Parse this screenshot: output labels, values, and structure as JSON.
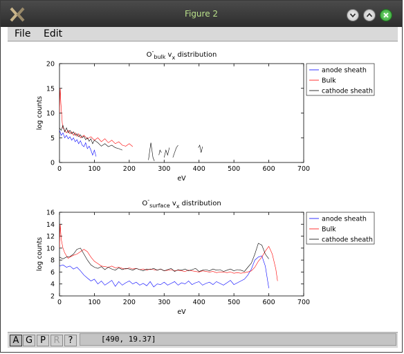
{
  "window": {
    "title": "Figure 2"
  },
  "menu": {
    "file": "File",
    "edit": "Edit"
  },
  "toolbar": {
    "a": "A",
    "g": "G",
    "p": "P",
    "r": "R",
    "help": "?"
  },
  "status": {
    "coords": "[490, 19.37]"
  },
  "chart_data": [
    {
      "type": "line",
      "title": {
        "base": "O",
        "sup": "-",
        "sub": "bulk",
        "mid": " v",
        "sub2": "x",
        "tail": " distribution"
      },
      "xlabel": "eV",
      "ylabel": "log counts",
      "xlim": [
        0,
        700
      ],
      "ylim": [
        0,
        20
      ],
      "xticks": [
        "0",
        "100",
        "200",
        "300",
        "400",
        "500",
        "600",
        "700"
      ],
      "yticks": [
        "0",
        "5",
        "10",
        "15",
        "20"
      ],
      "legend_position": "outside-right-top",
      "series": [
        {
          "name": "anode sheath",
          "color": "#0000ff",
          "x": [
            0,
            5,
            10,
            15,
            20,
            25,
            30,
            35,
            40,
            45,
            50,
            55,
            60,
            65,
            70,
            75,
            80,
            85,
            90,
            95,
            100,
            105
          ],
          "y": [
            6.5,
            5.5,
            6,
            5,
            5.5,
            4.8,
            5.2,
            4.5,
            5,
            4.2,
            4.6,
            3.8,
            4.4,
            3.5,
            3.2,
            4,
            2.8,
            3.3,
            2.5,
            1.5,
            2.5,
            1.2
          ]
        },
        {
          "name": "Bulk",
          "color": "#ff0000",
          "x": [
            0,
            2,
            4,
            6,
            8,
            10,
            15,
            20,
            25,
            30,
            35,
            40,
            45,
            50,
            55,
            60,
            70,
            80,
            90,
            100,
            110,
            120,
            130,
            140,
            150,
            160,
            170,
            180,
            190,
            200,
            210
          ],
          "y": [
            10,
            15,
            12,
            10,
            8,
            7,
            6.5,
            6,
            6.5,
            5.8,
            6.2,
            5.5,
            6,
            5.3,
            5.8,
            5,
            5.5,
            4.8,
            5.2,
            4.5,
            5,
            4.2,
            4.8,
            4,
            4.5,
            3.8,
            4.2,
            3.5,
            3.3,
            3.8,
            3.2
          ]
        },
        {
          "name": "cathode sheath",
          "color": "#000000",
          "x": [
            0,
            5,
            10,
            15,
            20,
            25,
            30,
            35,
            40,
            45,
            50,
            55,
            60,
            65,
            70,
            75,
            80,
            85,
            90,
            95,
            100,
            110,
            120,
            130,
            140,
            150,
            160,
            170,
            180
          ],
          "y": [
            7,
            6.5,
            7.5,
            6.2,
            7,
            6,
            6.5,
            5.8,
            6.2,
            5.5,
            5.8,
            5.2,
            5.6,
            5,
            5.3,
            4.6,
            5,
            4.3,
            4.8,
            3.8,
            4.5,
            4,
            3.3,
            3.8,
            3.2,
            3.5,
            3,
            2.8,
            2.5
          ],
          "segments": [
            {
              "x": [
                255,
                258,
                262,
                265,
                268,
                272
              ],
              "y": [
                0.5,
                2,
                4,
                2.5,
                1,
                0.3
              ]
            },
            {
              "x": [
                285,
                288,
                292
              ],
              "y": [
                1.5,
                2.5,
                2
              ]
            },
            {
              "x": [
                300,
                305,
                310,
                315
              ],
              "y": [
                1,
                2.5,
                1.5,
                3
              ]
            },
            {
              "x": [
                325,
                330,
                335,
                340
              ],
              "y": [
                1,
                2,
                3,
                3.5
              ]
            },
            {
              "x": [
                398,
                402,
                406,
                410
              ],
              "y": [
                3,
                3.5,
                2,
                3.2
              ]
            }
          ]
        }
      ]
    },
    {
      "type": "line",
      "title": {
        "base": "O",
        "sup": "-",
        "sub": "surface",
        "mid": " v",
        "sub2": "x",
        "tail": " distribution"
      },
      "xlabel": "eV",
      "ylabel": "log counts",
      "xlim": [
        0,
        700
      ],
      "ylim": [
        2,
        16
      ],
      "xticks": [
        "0",
        "100",
        "200",
        "300",
        "400",
        "500",
        "600",
        "700"
      ],
      "yticks": [
        "2",
        "4",
        "6",
        "8",
        "10",
        "12",
        "14",
        "16"
      ],
      "legend_position": "outside-right-top",
      "series": [
        {
          "name": "anode sheath",
          "color": "#0000ff",
          "x": [
            0,
            10,
            20,
            30,
            40,
            50,
            60,
            70,
            80,
            90,
            100,
            110,
            120,
            130,
            140,
            150,
            160,
            170,
            180,
            190,
            200,
            210,
            220,
            230,
            240,
            250,
            260,
            270,
            280,
            290,
            300,
            310,
            320,
            330,
            340,
            350,
            360,
            370,
            380,
            390,
            400,
            410,
            420,
            430,
            440,
            450,
            460,
            470,
            480,
            490,
            500,
            510,
            520,
            530,
            540,
            550,
            560,
            570,
            580,
            590,
            600
          ],
          "y": [
            7,
            7.2,
            6.8,
            7,
            6.5,
            6.8,
            6.2,
            5.5,
            5,
            4.5,
            4.8,
            4,
            4.5,
            3.8,
            4.2,
            4.6,
            3.6,
            4.4,
            3.8,
            4.2,
            4.5,
            4,
            4.3,
            3.8,
            4.1,
            3.7,
            4.4,
            3.5,
            4,
            3.9,
            4.3,
            3.8,
            4.1,
            4.4,
            3.8,
            4.2,
            4,
            4.5,
            3.9,
            4.2,
            4.4,
            3.8,
            4.1,
            4.3,
            3.9,
            4.4,
            4.1,
            3.8,
            4.2,
            4.6,
            3.9,
            4.2,
            4.5,
            4.8,
            5.5,
            6.5,
            8,
            8.5,
            8.7,
            7,
            3.3
          ]
        },
        {
          "name": "Bulk",
          "color": "#ff0000",
          "x": [
            0,
            2,
            5,
            10,
            15,
            20,
            25,
            30,
            40,
            50,
            60,
            70,
            80,
            90,
            100,
            110,
            120,
            130,
            140,
            150,
            160,
            170,
            180,
            190,
            200,
            210,
            220,
            230,
            240,
            250,
            260,
            270,
            280,
            290,
            300,
            310,
            320,
            330,
            340,
            350,
            360,
            370,
            380,
            390,
            400,
            410,
            420,
            430,
            440,
            450,
            460,
            470,
            480,
            490,
            500,
            510,
            520,
            530,
            540,
            550,
            560,
            570,
            580,
            590,
            600,
            610,
            620,
            625
          ],
          "y": [
            10,
            14,
            11.5,
            10,
            9.2,
            8.7,
            8.3,
            8.5,
            8.8,
            9,
            9.4,
            9.8,
            9.4,
            8.5,
            7.8,
            7.4,
            7,
            6.9,
            6.8,
            7,
            6.7,
            6.8,
            6.6,
            6.5,
            6.7,
            6.5,
            6.6,
            6.4,
            6.5,
            6.3,
            6.5,
            6.4,
            6.3,
            6.5,
            6.2,
            6.3,
            6.4,
            6.2,
            6.3,
            6.2,
            6.1,
            6.3,
            6.2,
            6.1,
            6,
            6.2,
            6.1,
            6,
            6.1,
            5.9,
            6,
            6,
            5.9,
            6,
            5.8,
            5.9,
            5.8,
            5.9,
            6,
            6.2,
            6.8,
            7.8,
            8.5,
            9.5,
            10.3,
            9,
            6.5,
            4.5
          ]
        },
        {
          "name": "cathode sheath",
          "color": "#000000",
          "x": [
            0,
            10,
            20,
            30,
            40,
            50,
            60,
            70,
            80,
            90,
            100,
            110,
            120,
            130,
            140,
            150,
            160,
            170,
            180,
            190,
            200,
            210,
            220,
            230,
            240,
            250,
            260,
            270,
            280,
            290,
            300,
            310,
            320,
            330,
            340,
            350,
            360,
            370,
            380,
            390,
            400,
            410,
            420,
            430,
            440,
            450,
            460,
            470,
            480,
            490,
            500,
            510,
            520,
            530,
            540,
            550,
            560,
            570,
            580,
            590,
            600
          ],
          "y": [
            8.5,
            8.2,
            8.5,
            8.6,
            9,
            9.8,
            10,
            9,
            8,
            7.2,
            6.8,
            6.6,
            6.9,
            6.4,
            6.8,
            6.5,
            6.3,
            6.7,
            6.4,
            6.6,
            6.5,
            6.3,
            6.6,
            6.4,
            6.2,
            6.5,
            6.4,
            6.6,
            6.3,
            6.5,
            6.2,
            6.4,
            6.6,
            6.1,
            6.4,
            6.3,
            6.5,
            6.2,
            6.4,
            6.6,
            6.1,
            6.3,
            6.4,
            6.2,
            6.5,
            6.3,
            6.4,
            6.1,
            6.3,
            6.5,
            6.2,
            6.4,
            6.3,
            6.1,
            6.8,
            7.5,
            9,
            10.8,
            10.5,
            9,
            8.2
          ]
        }
      ]
    }
  ]
}
